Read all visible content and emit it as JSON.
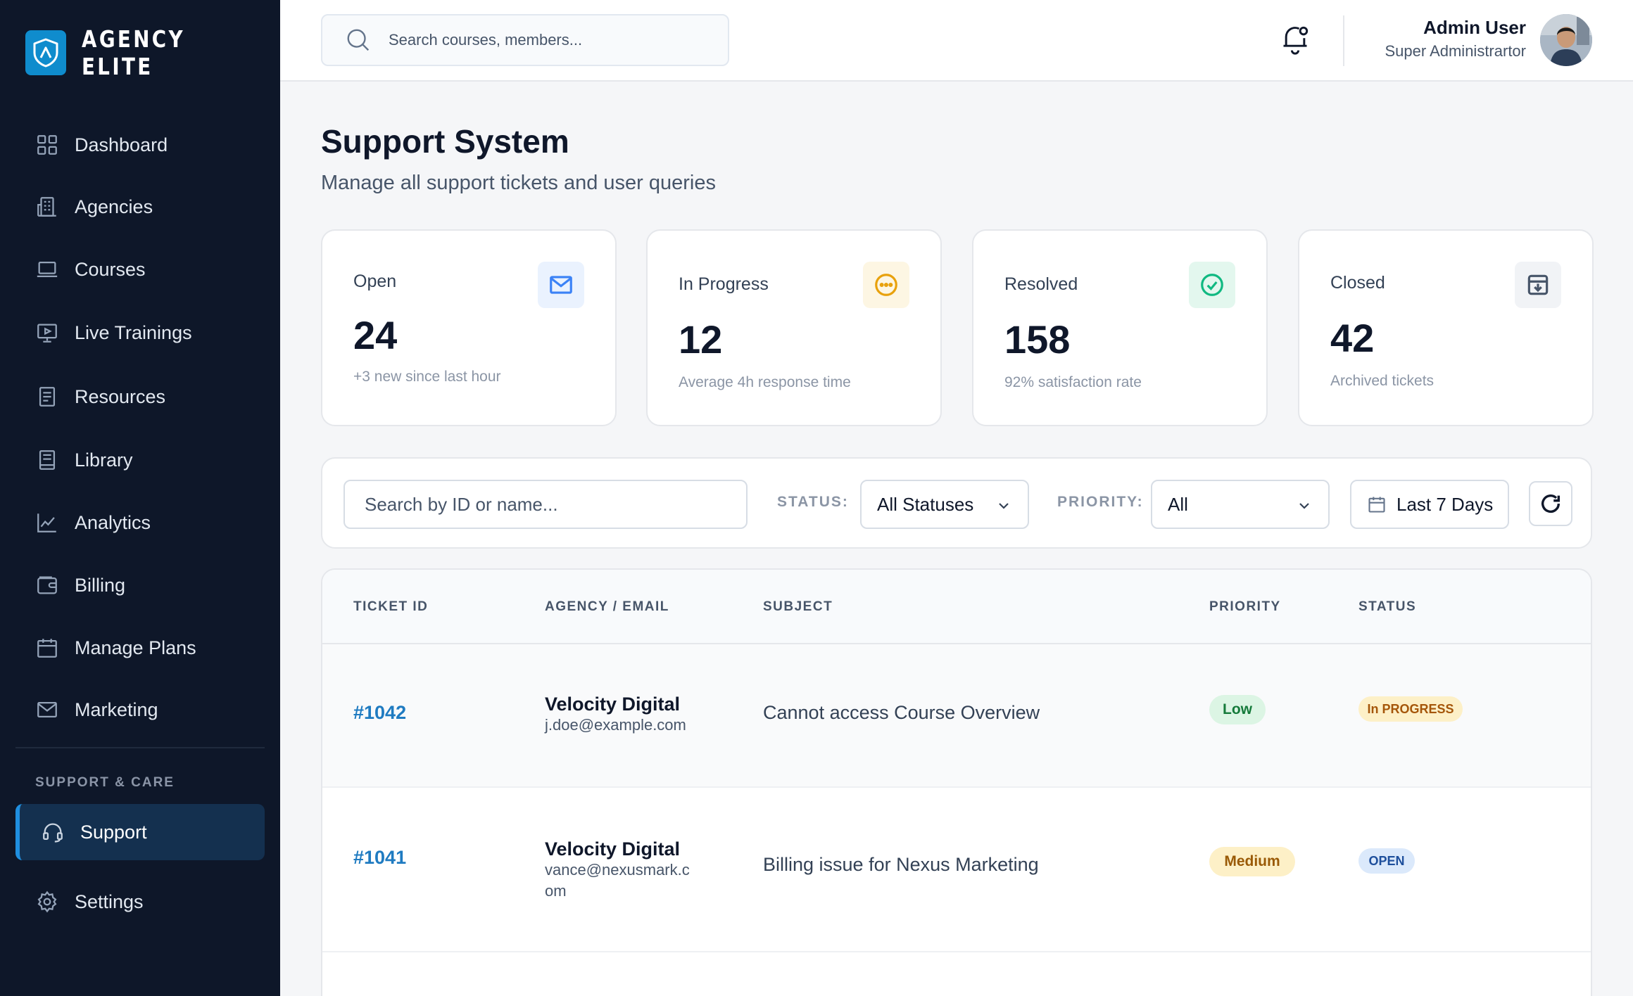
{
  "brand": {
    "name": "AGENCY ELITE"
  },
  "sidebar": {
    "items": [
      {
        "label": "Dashboard",
        "icon": "grid-icon"
      },
      {
        "label": "Agencies",
        "icon": "building-icon"
      },
      {
        "label": "Courses",
        "icon": "laptop-icon"
      },
      {
        "label": "Live Trainings",
        "icon": "monitor-play-icon"
      },
      {
        "label": "Resources",
        "icon": "document-icon"
      },
      {
        "label": "Library",
        "icon": "book-icon"
      },
      {
        "label": "Analytics",
        "icon": "line-chart-icon"
      },
      {
        "label": "Billing",
        "icon": "wallet-icon"
      },
      {
        "label": "Manage Plans",
        "icon": "calendar-icon"
      },
      {
        "label": "Marketing",
        "icon": "mail-icon"
      }
    ],
    "section_label": "SUPPORT & CARE",
    "support": {
      "label": "Support",
      "icon": "headset-icon",
      "active": true
    },
    "settings": {
      "label": "Settings",
      "icon": "gear-icon"
    }
  },
  "header": {
    "search_placeholder": "Search courses, members...",
    "user_name": "Admin User",
    "user_role": "Super Administrartor"
  },
  "page": {
    "title": "Support System",
    "subtitle": "Manage all support tickets and user queries"
  },
  "stats": [
    {
      "label": "Open",
      "value": "24",
      "note": "+3 new since last hour",
      "icon": "mail-icon",
      "color": "#3b82f6"
    },
    {
      "label": "In Progress",
      "value": "12",
      "note": "Average 4h response time",
      "icon": "dots-circle-icon",
      "color": "#e8a10c"
    },
    {
      "label": "Resolved",
      "value": "158",
      "note": "92% satisfaction rate",
      "icon": "check-circle-icon",
      "color": "#10b981"
    },
    {
      "label": "Closed",
      "value": "42",
      "note": "Archived tickets",
      "icon": "archive-icon",
      "color": "#475569"
    }
  ],
  "filters": {
    "search_placeholder": "Search by ID or name...",
    "status_label": "STATUS:",
    "status_value": "All Statuses",
    "priority_label": "PRIORITY:",
    "priority_value": "All",
    "date_value": "Last 7 Days"
  },
  "table": {
    "columns": [
      "TICKET ID",
      "AGENCY / EMAIL",
      "SUBJECT",
      "PRIORITY",
      "STATUS"
    ],
    "rows": [
      {
        "id": "#1042",
        "agency": "Velocity Digital",
        "email": "j.doe@example.com",
        "subject": "Cannot access Course Overview",
        "priority": "Low",
        "status": "In PROGRESS"
      },
      {
        "id": "#1041",
        "agency": "Velocity Digital",
        "email": "vance@nexusmark.com",
        "subject": "Billing issue for Nexus Marketing",
        "priority": "Medium",
        "status": "OPEN"
      }
    ]
  },
  "colors": {
    "sidebar_bg": "#0e1729",
    "accent": "#0f8ccd",
    "link": "#1f7bc1"
  }
}
